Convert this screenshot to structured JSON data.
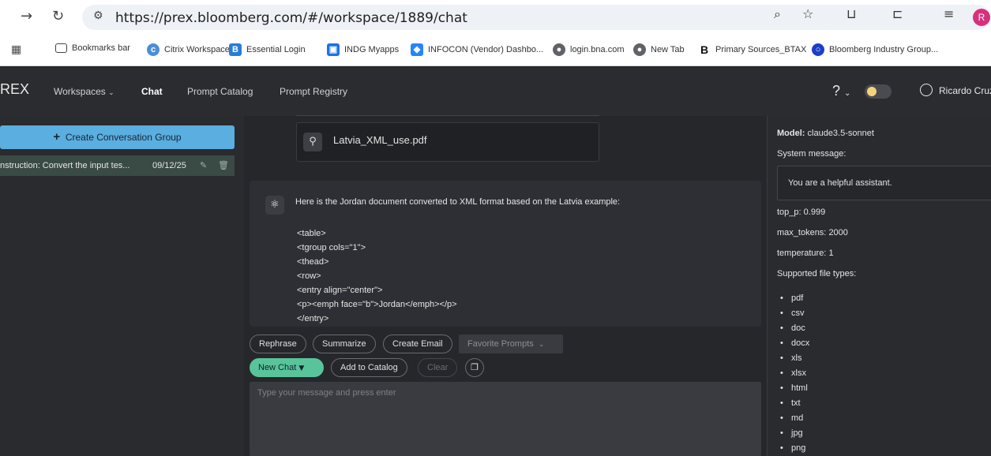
{
  "browser": {
    "url": "https://prex.bloomberg.com/#/workspace/1889/chat",
    "profile_initial": "R",
    "bookmarks": [
      {
        "label": "Bookmarks bar",
        "icon": "folder-icon"
      },
      {
        "label": "Citrix Workspace",
        "icon": "citrix-icon"
      },
      {
        "label": "Essential Login",
        "icon": "b-logo-icon"
      },
      {
        "label": "INDG Myapps",
        "icon": "lock-icon"
      },
      {
        "label": "INFOCON (Vendor) Dashbo...",
        "icon": "jira-icon"
      },
      {
        "label": "login.bna.com",
        "icon": "globe-icon"
      },
      {
        "label": "New Tab",
        "icon": "globe-icon"
      },
      {
        "label": "Primary Sources_BTAX",
        "icon": "b-letter-icon"
      },
      {
        "label": "Bloomberg Industry Group...",
        "icon": "circle-logo-icon"
      }
    ]
  },
  "app": {
    "brand": "REX",
    "nav": {
      "workspaces": "Workspaces",
      "chat": "Chat",
      "prompt_catalog": "Prompt Catalog",
      "prompt_registry": "Prompt Registry"
    },
    "help": "?",
    "user_name": "Ricardo Cruz"
  },
  "sidebar": {
    "create_label": "Create Conversation Group",
    "conversations": [
      {
        "title": "nstruction: Convert the input tes...",
        "date": "09/12/25"
      }
    ]
  },
  "chat": {
    "attachment": "Latvia_XML_use.pdf",
    "intro": "Here is the Jordan document converted to XML format based on the Latvia example:",
    "code_lines": [
      "<table>",
      "<tgroup cols=\"1\">",
      "<thead>",
      "<row>",
      "<entry align=\"center\">",
      "<p><emph face=\"b\">Jordan</emph></p>",
      "</entry>"
    ],
    "actions": {
      "rephrase": "Rephrase",
      "summarize": "Summarize",
      "create_email": "Create Email",
      "favorite_prompts": "Favorite Prompts",
      "new_chat": "New Chat",
      "add_to_catalog": "Add to Catalog",
      "clear": "Clear"
    },
    "input_placeholder": "Type your message and press enter"
  },
  "settings": {
    "model_label": "Model:",
    "model": "claude3.5-sonnet",
    "system_message_label": "System message:",
    "system_message": "You are a helpful assistant.",
    "top_p_label": "top_p:",
    "top_p": "0.999",
    "max_tokens_label": "max_tokens:",
    "max_tokens": "2000",
    "temperature_label": "temperature:",
    "temperature": "1",
    "file_types_label": "Supported file types:",
    "file_types": [
      "pdf",
      "csv",
      "doc",
      "docx",
      "xls",
      "xlsx",
      "html",
      "txt",
      "md",
      "jpg",
      "png"
    ]
  },
  "colors": {
    "accent_blue": "#5aaee0",
    "accent_green": "#59c49a",
    "profile_pink": "#d7317c"
  }
}
